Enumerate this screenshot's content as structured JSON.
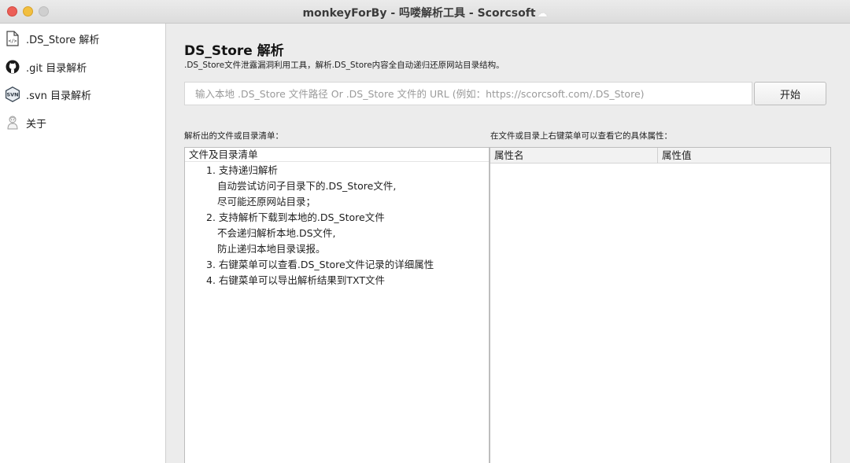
{
  "window": {
    "title": "monkeyForBy - 吗喽解析工具 - Scorcsoft",
    "title_suffix_icon": "cloud-icon"
  },
  "sidebar": {
    "items": [
      {
        "label": ".DS_Store 解析",
        "icon": "code-file-icon"
      },
      {
        "label": ".git 目录解析",
        "icon": "github-icon"
      },
      {
        "label": ".svn 目录解析",
        "icon": "svn-icon"
      },
      {
        "label": "关于",
        "icon": "about-icon"
      }
    ]
  },
  "main": {
    "title": "DS_Store 解析",
    "subtitle": ".DS_Store文件泄露漏洞利用工具，解析.DS_Store内容全自动递归还原网站目录结构。",
    "input": {
      "value": "",
      "placeholder": "输入本地 .DS_Store 文件路径 Or .DS_Store 文件的 URL (例如：https://scorcsoft.com/.DS_Store)"
    },
    "start_button": "开始",
    "left_label": "解析出的文件或目录清单：",
    "right_label": "在文件或目录上右键菜单可以查看它的具体属性：",
    "tree": {
      "header": "文件及目录清单",
      "lines": [
        "1. 支持递归解析",
        "自动尝试访问子目录下的.DS_Store文件,",
        "尽可能还原网站目录；",
        "2. 支持解析下载到本地的.DS_Store文件",
        "不会递归解析本地.DS文件,",
        "防止递归本地目录误报。",
        "3. 右键菜单可以查看.DS_Store文件记录的详细属性",
        "4. 右键菜单可以导出解析结果到TXT文件"
      ]
    },
    "props": {
      "col_name": "属性名",
      "col_value": "属性值"
    }
  }
}
